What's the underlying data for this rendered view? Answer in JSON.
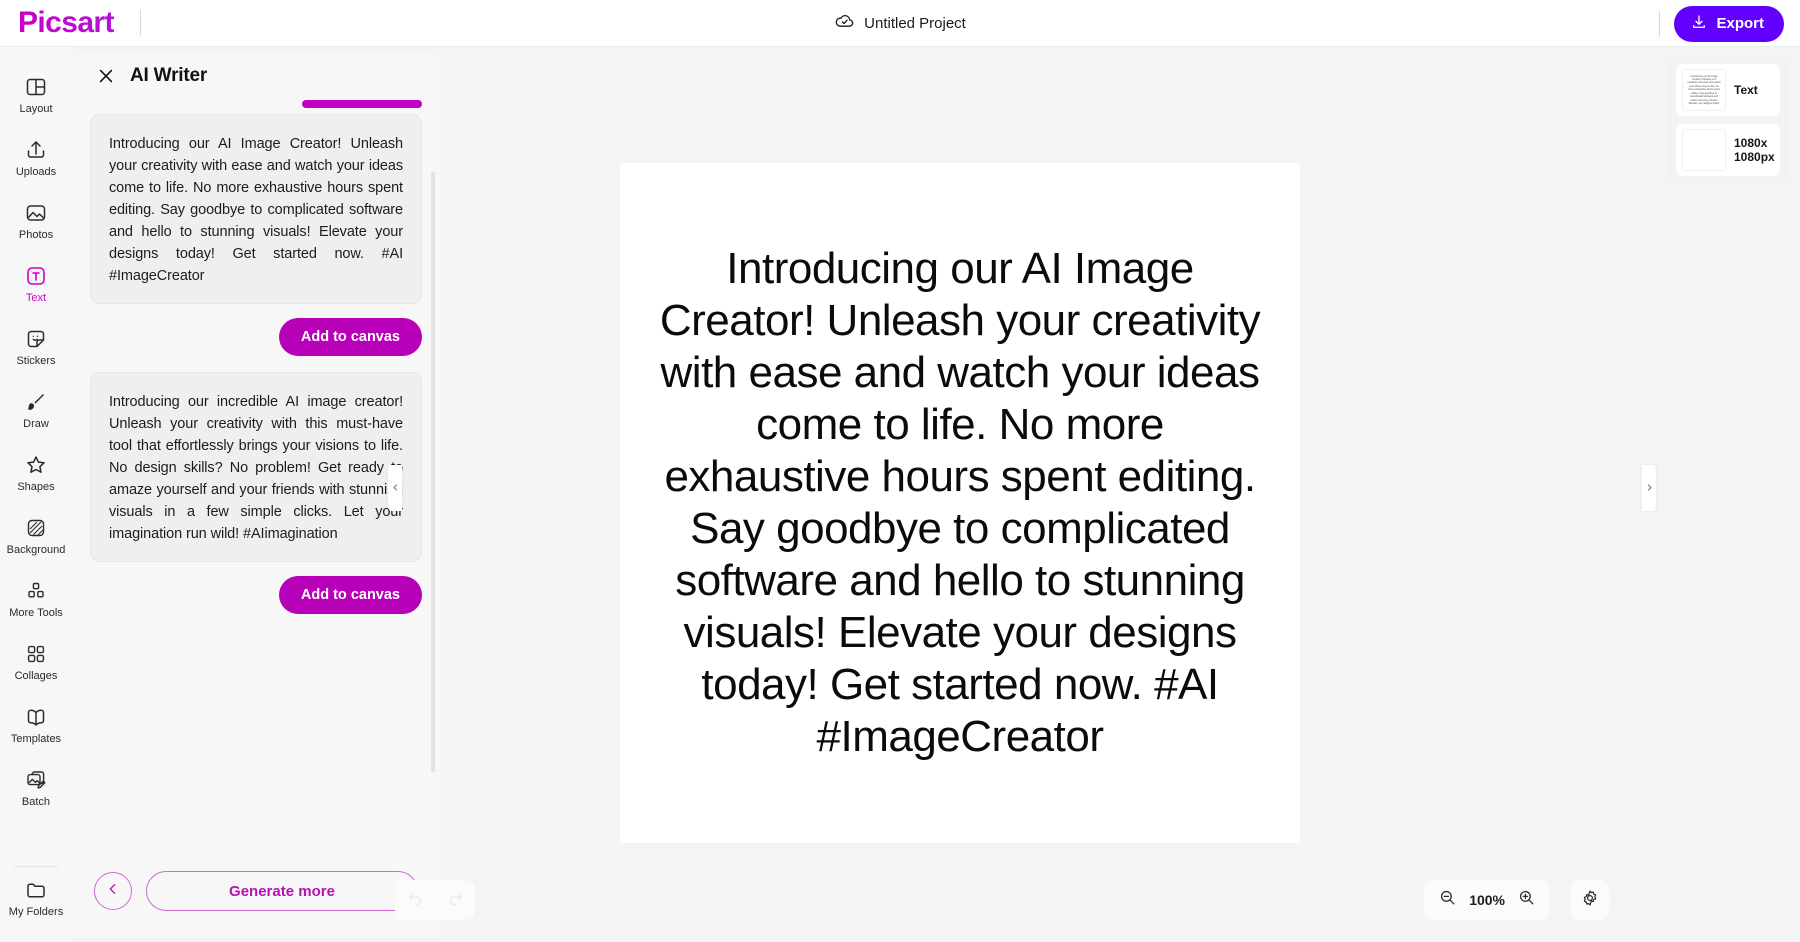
{
  "app": {
    "brand": "Picsart"
  },
  "topbar": {
    "project_title": "Untitled Project",
    "cloud_icon": "cloud-check-icon",
    "export_label": "Export",
    "export_icon": "download-icon",
    "export_color": "#6100ff"
  },
  "sidebar": {
    "items": [
      {
        "label": "Layout",
        "icon": "layout-icon",
        "active": false
      },
      {
        "label": "Uploads",
        "icon": "upload-icon",
        "active": false
      },
      {
        "label": "Photos",
        "icon": "photo-icon",
        "active": false
      },
      {
        "label": "Text",
        "icon": "text-t-icon",
        "active": true
      },
      {
        "label": "Stickers",
        "icon": "sticker-icon",
        "active": false
      },
      {
        "label": "Draw",
        "icon": "brush-icon",
        "active": false
      },
      {
        "label": "Shapes",
        "icon": "star-icon",
        "active": false
      },
      {
        "label": "Background",
        "icon": "background-icon",
        "active": false
      },
      {
        "label": "More Tools",
        "icon": "more-tools-icon",
        "active": false
      },
      {
        "label": "Collages",
        "icon": "collage-grid-icon",
        "active": false
      },
      {
        "label": "Templates",
        "icon": "templates-book-icon",
        "active": false
      },
      {
        "label": "Batch",
        "icon": "batch-icon",
        "active": false
      }
    ],
    "bottom": {
      "label": "My Folders",
      "icon": "folder-icon"
    },
    "active_color": "#cc00cc"
  },
  "panel": {
    "title": "AI Writer",
    "close_icon": "close-icon",
    "results": [
      {
        "text": "Introducing our AI Image Creator! Unleash your creativity with ease and watch your ideas come to life. No more exhaustive hours spent editing. Say goodbye to complicated software and hello to stunning visuals! Elevate your designs today! Get started now. #AI #ImageCreator",
        "add_label": "Add to canvas"
      },
      {
        "text": "Introducing our incredible AI image creator! Unleash your creativity with this must-have tool that effortlessly brings your visions to life. No design skills? No problem! Get ready to amaze yourself and your friends with stunning visuals in a few simple clicks. Let your imagination run wild! #AIimagination",
        "add_label": "Add to canvas"
      }
    ],
    "back_icon": "chevron-left-icon",
    "generate_label": "Generate more",
    "accent_color": "#b800b8"
  },
  "canvas": {
    "text": "Introducing our AI Image Creator! Unleash your creativity with ease and watch your ideas come to life. No more exhaustive hours spent editing. Say goodbye to complicated software and hello to stunning visuals! Elevate your designs today! Get started now. #AI #ImageCreator",
    "collapse_left_icon": "chevron-left-icon",
    "collapse_right_icon": "chevron-right-icon"
  },
  "toolbar": {
    "undo_icon": "undo-icon",
    "redo_icon": "redo-icon",
    "zoom_out_icon": "zoom-out-icon",
    "zoom_in_icon": "zoom-in-icon",
    "zoom_value": "100%",
    "settings_icon": "gear-icon"
  },
  "layers": {
    "items": [
      {
        "name": "Text",
        "thumb_text": "Introducing our AI Image Creator! Unleash your creativity with ease and watch your ideas come to life. No more exhaustive hours spent editing. Say goodbye to complicated software and hello to stunning visuals! Elevate your designs today!"
      },
      {
        "name": "1080x 1080px",
        "thumb_text": ""
      }
    ]
  }
}
